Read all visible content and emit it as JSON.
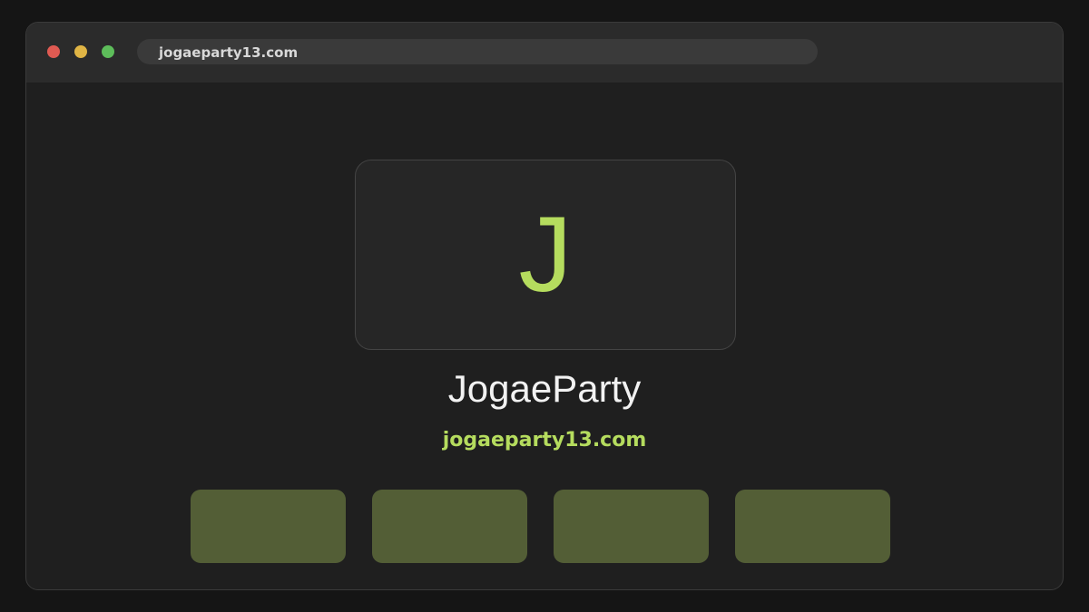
{
  "browser": {
    "url": "jogaeparty13.com",
    "controls": [
      "close",
      "minimize",
      "maximize"
    ]
  },
  "site": {
    "logo_letter": "J",
    "title": "JogaeParty",
    "domain": "jogaeparty13.com"
  },
  "tiles": [
    {
      "label": ""
    },
    {
      "label": ""
    },
    {
      "label": ""
    },
    {
      "label": ""
    }
  ],
  "colors": {
    "accent": "#b5dc5e",
    "tile": "#535e36",
    "background": "#1f1f1f",
    "titlebar": "#2b2b2b"
  }
}
